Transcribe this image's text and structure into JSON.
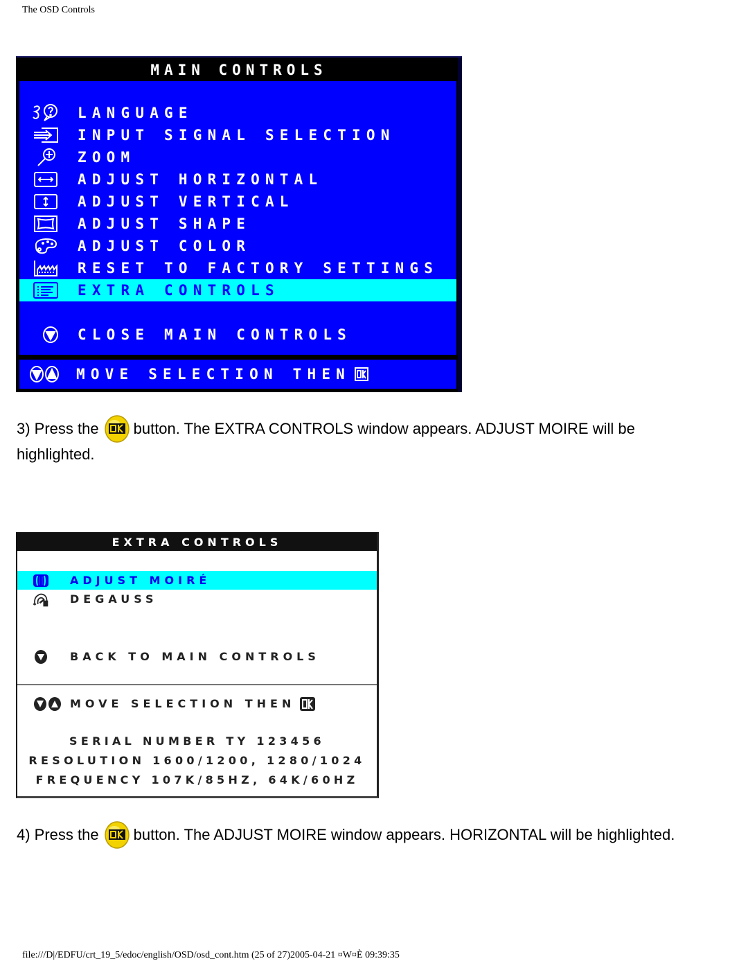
{
  "page": {
    "header_title": "The OSD Controls",
    "footer_text": "file:///D|/EDFU/crt_19_5/edoc/english/OSD/osd_cont.htm (25 of 27)2005-04-21 ¤W¤È 09:39:35"
  },
  "main_controls": {
    "title": "MAIN CONTROLS",
    "items": [
      {
        "icon": "language-icon",
        "label": "LANGUAGE",
        "selected": false
      },
      {
        "icon": "input-signal-icon",
        "label": "INPUT SIGNAL SELECTION",
        "selected": false
      },
      {
        "icon": "zoom-icon",
        "label": "ZOOM",
        "selected": false
      },
      {
        "icon": "horizontal-arrows-icon",
        "label": "ADJUST HORIZONTAL",
        "selected": false
      },
      {
        "icon": "vertical-arrows-icon",
        "label": "ADJUST VERTICAL",
        "selected": false
      },
      {
        "icon": "shape-icon",
        "label": "ADJUST SHAPE",
        "selected": false
      },
      {
        "icon": "palette-icon",
        "label": "ADJUST COLOR",
        "selected": false
      },
      {
        "icon": "factory-icon",
        "label": "RESET TO FACTORY SETTINGS",
        "selected": false
      },
      {
        "icon": "list-icon",
        "label": "EXTRA CONTROLS",
        "selected": true
      }
    ],
    "close_label": "CLOSE MAIN CONTROLS",
    "footer_label": "MOVE SELECTION THEN",
    "colors": {
      "background": "#0000ff",
      "highlight": "#00ffff",
      "text": "#ffffff",
      "frame": "#000000"
    }
  },
  "steps": [
    {
      "prefix": "3) Press the",
      "button_icon": "ok-button-icon",
      "suffix": "button. The EXTRA CONTROLS window appears. ADJUST MOIRE will be",
      "continuation": "highlighted."
    },
    {
      "prefix": "4) Press the",
      "button_icon": "ok-button-icon",
      "suffix": "button. The ADJUST MOIRE window appears. HORIZONTAL will be highlighted."
    }
  ],
  "extra_controls": {
    "title": "EXTRA CONTROLS",
    "items": [
      {
        "icon": "moire-icon",
        "label": "ADJUST MOIRÉ",
        "selected": true
      },
      {
        "icon": "degauss-icon",
        "label": "DEGAUSS",
        "selected": false
      }
    ],
    "back_label": "BACK TO MAIN CONTROLS",
    "footer_label": "MOVE SELECTION THEN",
    "info": {
      "serial": "SERIAL NUMBER TY 123456",
      "resolution": "RESOLUTION 1600/1200, 1280/1024",
      "frequency": "FREQUENCY 107K/85HZ, 64K/60HZ"
    },
    "colors": {
      "background": "#ffffff",
      "highlight": "#00ffff",
      "selected_text": "#0000ee",
      "text": "#222222"
    }
  }
}
